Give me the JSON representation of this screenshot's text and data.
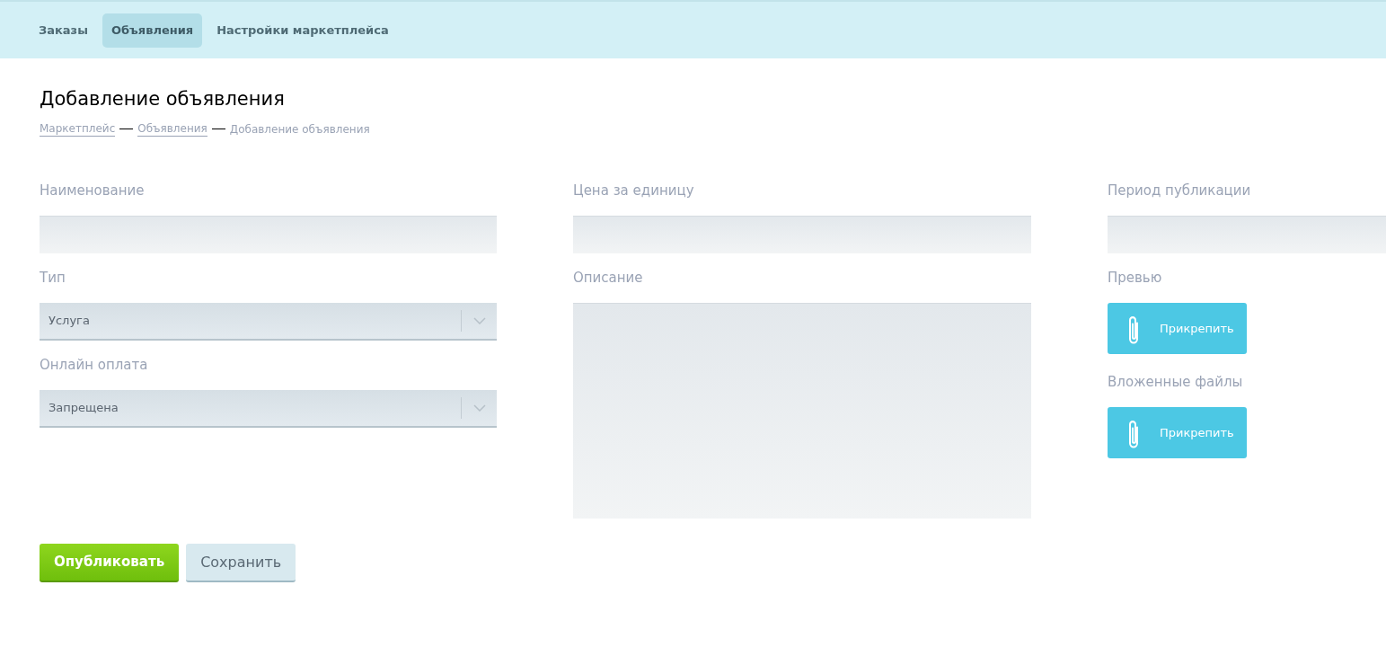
{
  "nav": {
    "tabs": [
      {
        "label": "Заказы",
        "selected": false
      },
      {
        "label": "Объявления",
        "selected": true
      },
      {
        "label": "Настройки маркетплейса",
        "selected": false
      }
    ]
  },
  "page": {
    "title": "Добавление объявления",
    "breadcrumbs": [
      {
        "label": "Маркетплейс",
        "kind": "link"
      },
      {
        "label": "Объявления",
        "kind": "link"
      },
      {
        "label": "Добавление объявления",
        "kind": "current"
      }
    ]
  },
  "form": {
    "columns": [
      [
        {
          "kind": "text",
          "label": "Наименование"
        },
        {
          "kind": "select",
          "label": "Тип",
          "value": "Услуга"
        },
        {
          "kind": "select",
          "label": "Онлайн оплата",
          "value": "Запрещена"
        }
      ],
      [
        {
          "kind": "text",
          "label": "Цена за единицу"
        },
        {
          "kind": "textarea",
          "label": "Описание"
        }
      ],
      [
        {
          "kind": "text",
          "label": "Период публикации"
        },
        {
          "kind": "attach",
          "label": "Превью",
          "button": "Прикрепить"
        },
        {
          "kind": "attach",
          "label": "Вложенные файлы",
          "button": "Прикрепить"
        }
      ]
    ]
  },
  "actions": [
    {
      "label": "Опубликовать",
      "kind": "primary"
    },
    {
      "label": "Сохранить",
      "kind": "secondary"
    }
  ]
}
